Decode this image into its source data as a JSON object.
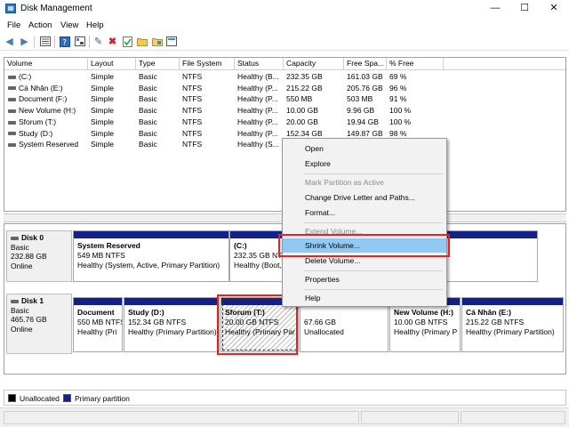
{
  "window": {
    "title": "Disk Management"
  },
  "menu": [
    "File",
    "Action",
    "View",
    "Help"
  ],
  "toolbar": {
    "icons": [
      "back-arrow-icon",
      "forward-arrow-icon",
      "properties-list-icon",
      "help-icon",
      "settings-icon",
      "pen-icon",
      "delete-x-icon",
      "check-doc-icon",
      "open-folder-icon",
      "folder-icon",
      "console-icon"
    ]
  },
  "volumes": {
    "headers": [
      "Volume",
      "Layout",
      "Type",
      "File System",
      "Status",
      "Capacity",
      "Free Spa...",
      "% Free"
    ],
    "rows": [
      [
        "(C:)",
        "Simple",
        "Basic",
        "NTFS",
        "Healthy (B...",
        "232.35 GB",
        "161.03 GB",
        "69 %"
      ],
      [
        "Cá Nhân (E:)",
        "Simple",
        "Basic",
        "NTFS",
        "Healthy (P...",
        "215.22 GB",
        "205.76 GB",
        "96 %"
      ],
      [
        "Document (F:)",
        "Simple",
        "Basic",
        "NTFS",
        "Healthy (P...",
        "550 MB",
        "503 MB",
        "91 %"
      ],
      [
        "New Volume (H:)",
        "Simple",
        "Basic",
        "NTFS",
        "Healthy (P...",
        "10.00 GB",
        "9.96 GB",
        "100 %"
      ],
      [
        "Sforum (T:)",
        "Simple",
        "Basic",
        "NTFS",
        "Healthy (P...",
        "20.00 GB",
        "19.94 GB",
        "100 %"
      ],
      [
        "Study (D:)",
        "Simple",
        "Basic",
        "NTFS",
        "Healthy (P...",
        "152.34 GB",
        "149.87 GB",
        "98 %"
      ],
      [
        "System Reserved",
        "Simple",
        "Basic",
        "NTFS",
        "Healthy (S...",
        "",
        "",
        ""
      ]
    ]
  },
  "disks": [
    {
      "name": "Disk 0",
      "type": "Basic",
      "size": "232.88 GB",
      "state": "Online",
      "partitions": [
        {
          "name": "System Reserved",
          "size": "549 MB NTFS",
          "status": "Healthy (System, Active, Primary Partition)"
        },
        {
          "name": "(C:)",
          "size": "232.35 GB NTFS",
          "status": "Healthy (Boot,"
        }
      ]
    },
    {
      "name": "Disk 1",
      "type": "Basic",
      "size": "465.76 GB",
      "state": "Online",
      "partitions": [
        {
          "name": "Document",
          "size": "550 MB NTFS",
          "status": "Healthy (Pri"
        },
        {
          "name": "Study  (D:)",
          "size": "152.34 GB NTFS",
          "status": "Healthy (Primary Partition)"
        },
        {
          "name": "Sforum  (T:)",
          "size": "20.00 GB NTFS",
          "status": "Healthy (Primary Par"
        },
        {
          "name": "",
          "size": "67.66 GB",
          "status": "Unallocated"
        },
        {
          "name": "New Volume  (H:)",
          "size": "10.00 GB NTFS",
          "status": "Healthy (Primary P"
        },
        {
          "name": "Cá Nhân  (E:)",
          "size": "215.22 GB NTFS",
          "status": "Healthy (Primary Partition)"
        }
      ]
    }
  ],
  "legend": {
    "unallocated": "Unallocated",
    "primary": "Primary partition"
  },
  "context_menu": {
    "items": [
      {
        "label": "Open",
        "disabled": false
      },
      {
        "label": "Explore",
        "disabled": false
      },
      {
        "label": "Mark Partition as Active",
        "disabled": true
      },
      {
        "label": "Change Drive Letter and Paths...",
        "disabled": false
      },
      {
        "label": "Format...",
        "disabled": false
      },
      {
        "label": "Extend Volume...",
        "disabled": true
      },
      {
        "label": "Shrink Volume...",
        "disabled": false,
        "highlighted": true
      },
      {
        "label": "Delete Volume...",
        "disabled": false
      },
      {
        "label": "Properties",
        "disabled": false
      },
      {
        "label": "Help",
        "disabled": false
      }
    ]
  },
  "colors": {
    "primary_partition": "#14208a",
    "unallocated": "#000000",
    "highlight": "#90c8f6",
    "annotation_red": "#e0252a"
  }
}
